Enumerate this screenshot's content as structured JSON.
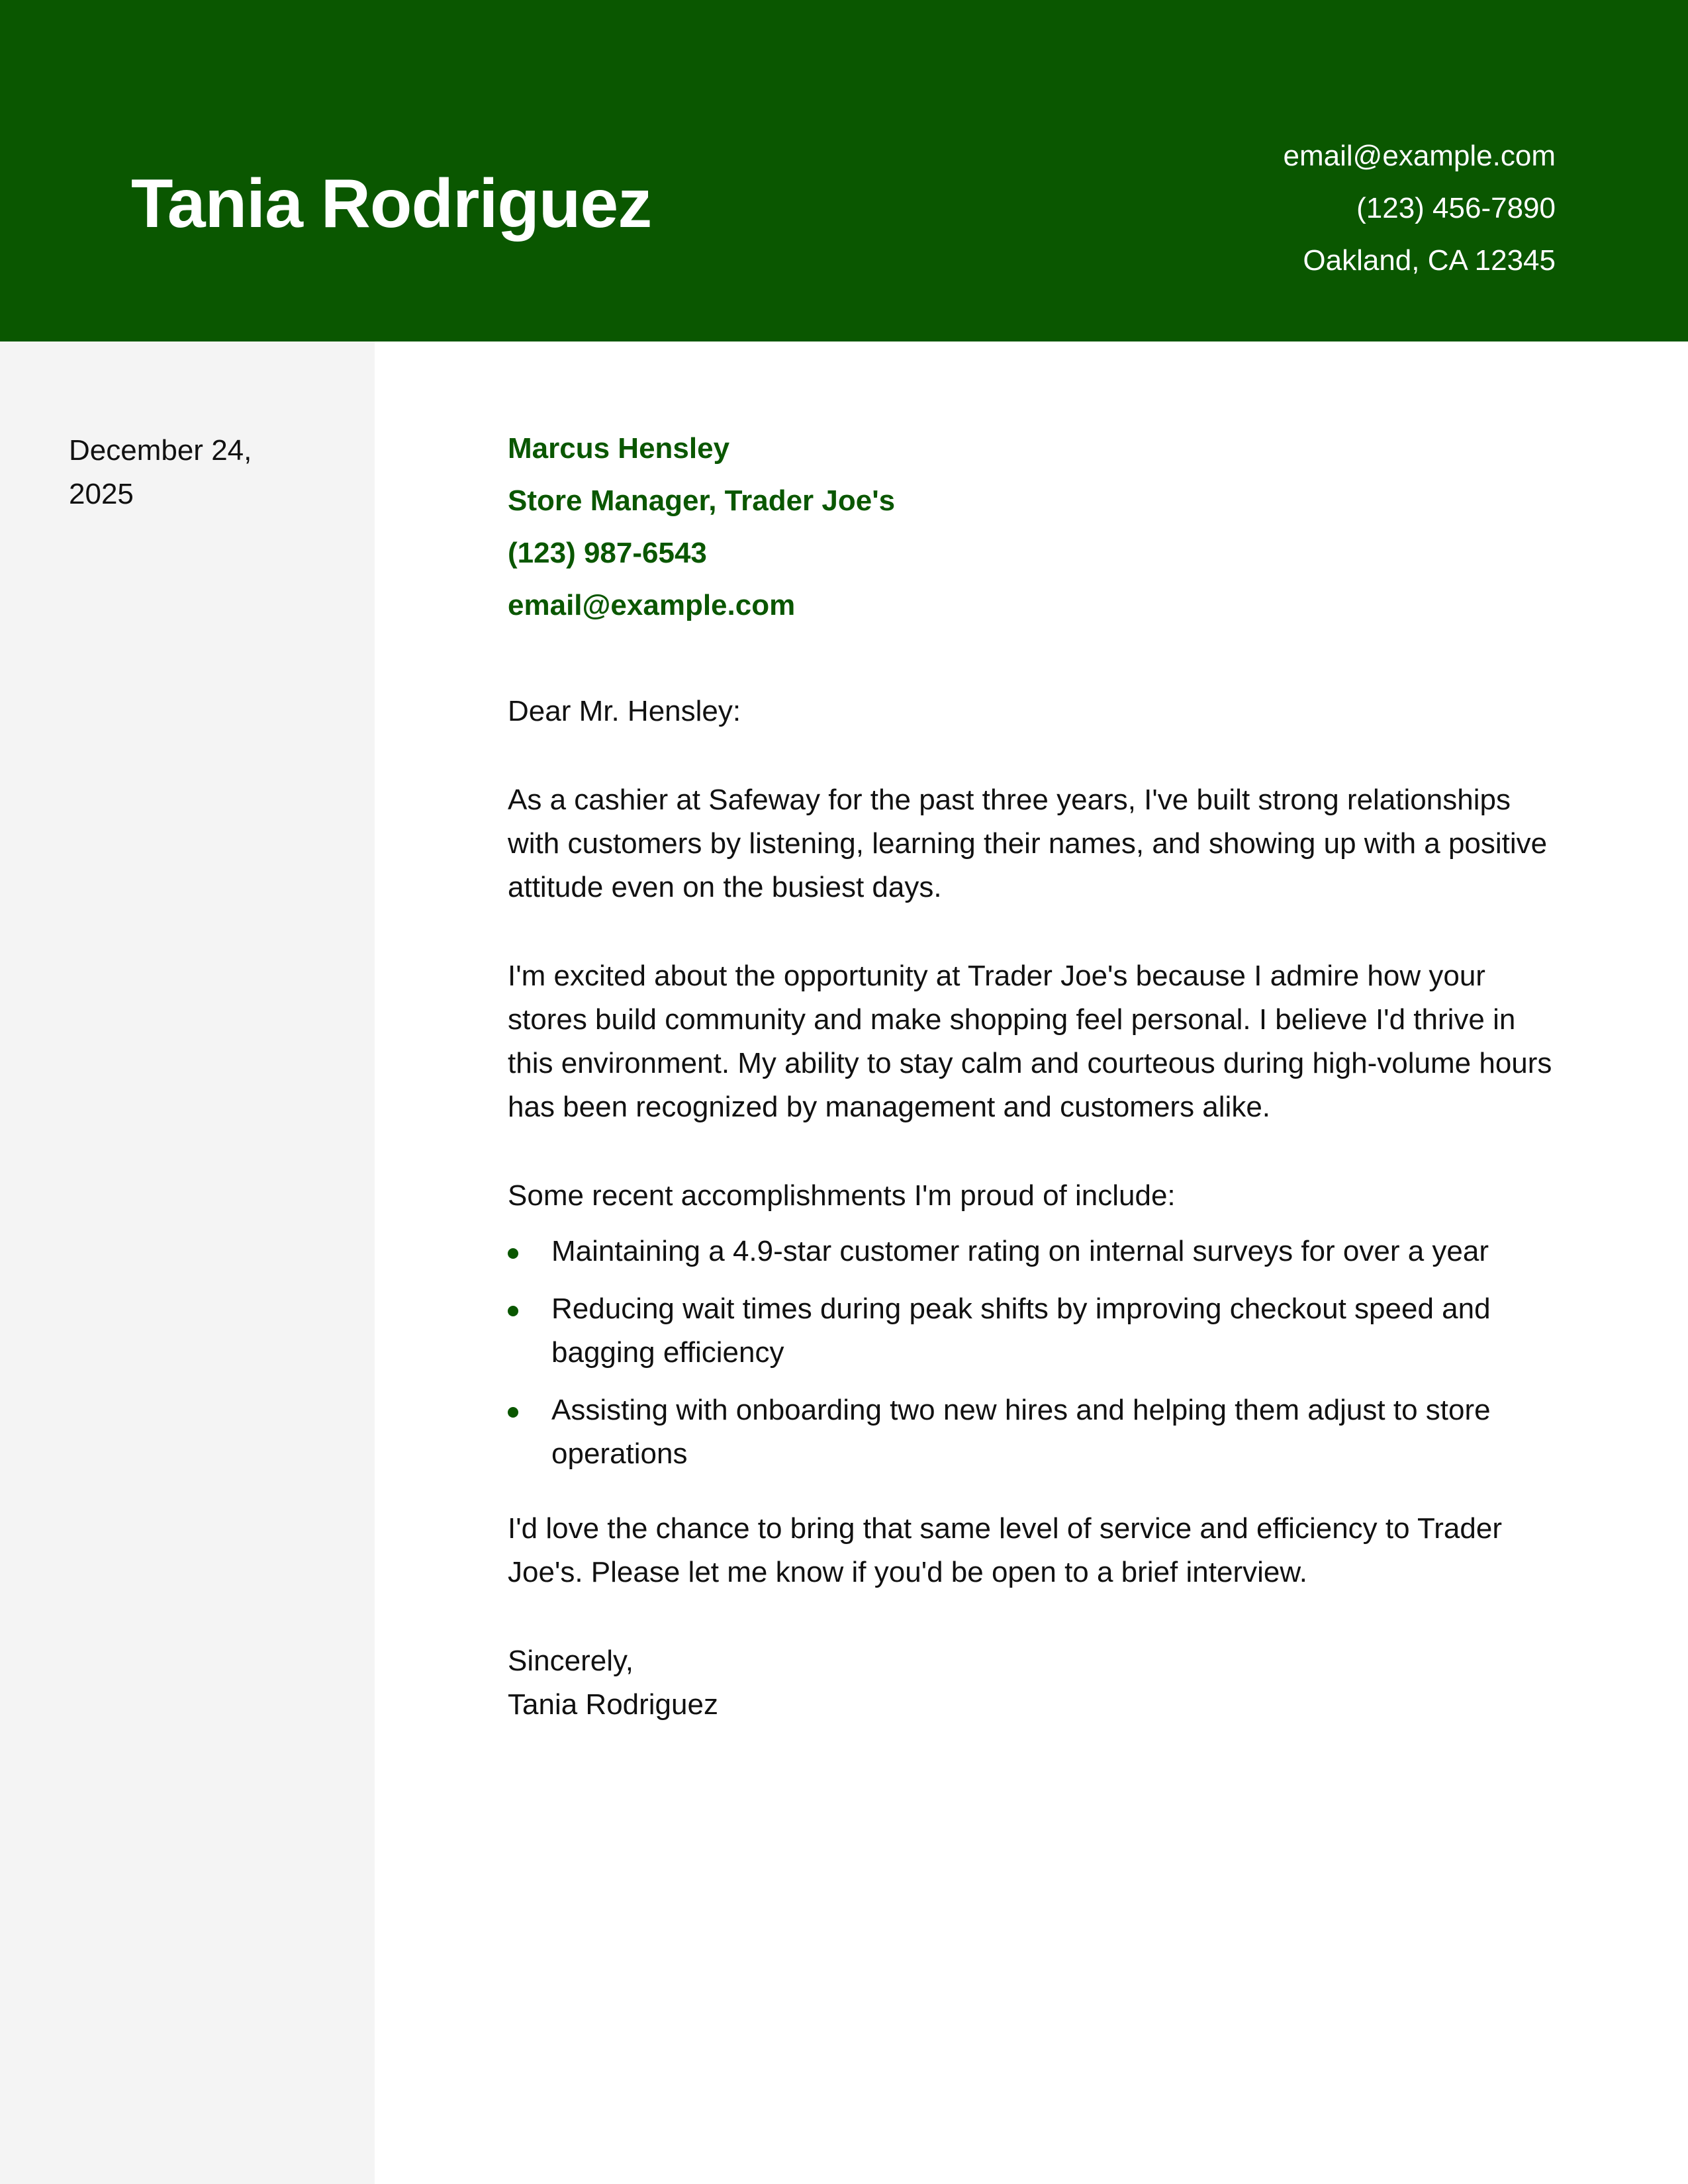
{
  "header": {
    "name": "Tania Rodriguez",
    "contact": {
      "email": "email@example.com",
      "phone": "(123) 456-7890",
      "location": "Oakland, CA 12345"
    }
  },
  "sidebar": {
    "date": "December 24, 2025"
  },
  "recipient": {
    "name": "Marcus Hensley",
    "title": "Store Manager, Trader Joe's",
    "phone": "(123) 987-6543",
    "email": "email@example.com"
  },
  "letter": {
    "salutation": "Dear Mr. Hensley:",
    "paragraphs": [
      "As a cashier at Safeway for the past three years, I've built strong relationships with customers by listening, learning their names, and showing up with a positive attitude even on the busiest days.",
      "I'm excited about the opportunity at Trader Joe's because I admire how your stores build community and make shopping feel personal. I believe I'd thrive in this environment. My ability to stay calm and courteous during high-volume hours has been recognized by management and customers alike.",
      "Some recent accomplishments I'm proud of include:",
      "I'd love the chance to bring that same level of service and efficiency to Trader Joe's. Please let me know if you'd be open to a brief interview."
    ],
    "bullets": [
      "Maintaining a 4.9-star customer rating on internal surveys for over a year",
      "Reducing wait times during peak shifts by improving checkout speed and bagging efficiency",
      "Assisting with onboarding two new hires and helping them adjust to store operations"
    ],
    "closing": "Sincerely,",
    "signature": "Tania Rodriguez"
  },
  "colors": {
    "accent": "#0a5700",
    "sidebar_bg": "#f4f4f4",
    "text": "#111111"
  }
}
